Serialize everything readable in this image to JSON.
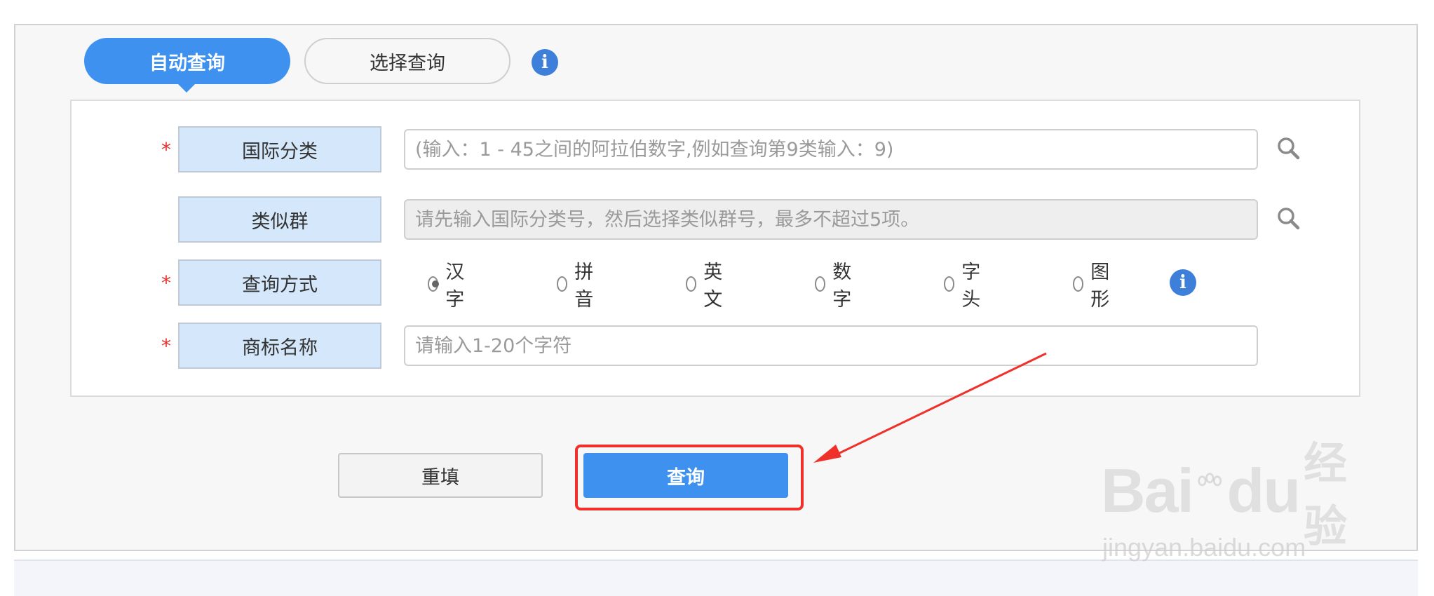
{
  "tabs": {
    "auto_label": "自动查询",
    "select_label": "选择查询"
  },
  "form": {
    "intl_class": {
      "label": "国际分类",
      "placeholder": "(输入：1 - 45之间的阿拉伯数字,例如查询第9类输入：9)"
    },
    "similar_group": {
      "label": "类似群",
      "placeholder": "请先输入国际分类号，然后选择类似群号，最多不超过5项。"
    },
    "query_mode": {
      "label": "查询方式",
      "options": [
        "汉字",
        "拼音",
        "英文",
        "数字",
        "字头",
        "图形"
      ],
      "selected": "汉字"
    },
    "trademark_name": {
      "label": "商标名称",
      "placeholder": "请输入1-20个字符"
    },
    "required_mark": "*"
  },
  "actions": {
    "reset_label": "重填",
    "query_label": "查询"
  },
  "icons": {
    "info": "info-icon",
    "search": "search-icon"
  },
  "watermark": {
    "logo_text": "Bai",
    "logo_text2": "du",
    "logo_cn": "经验",
    "url": "jingyan.baidu.com"
  },
  "colors": {
    "primary": "#3f91f0",
    "label_bg": "#d5e8fb",
    "required": "#e5322d",
    "annotation": "#f0312b"
  }
}
